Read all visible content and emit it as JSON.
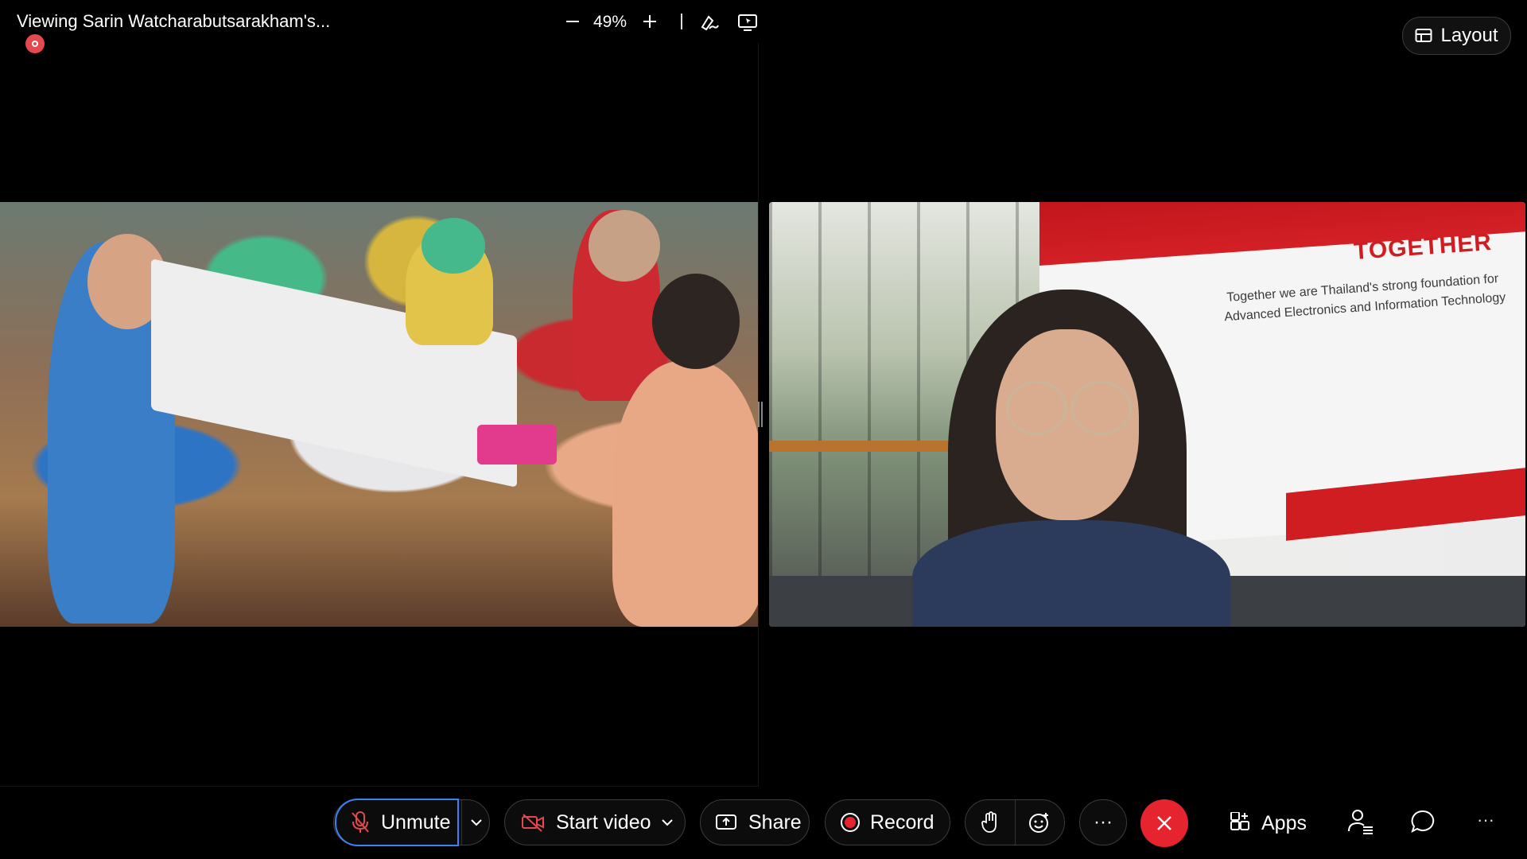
{
  "share": {
    "title": "Viewing Sarin Watcharabutsarakham's...",
    "zoom": "49%"
  },
  "participant_video": {
    "brand_text": "TOGETHER",
    "tagline_line1": "Together we are Thailand's strong foundation for",
    "tagline_line2": "Advanced Electronics and Information Technology"
  },
  "header": {
    "layout_label": "Layout"
  },
  "toolbar": {
    "unmute_label": "Unmute",
    "start_video_label": "Start video",
    "share_label": "Share",
    "record_label": "Record",
    "more_label": "···",
    "apps_label": "Apps",
    "overflow_label": "···"
  },
  "icons": {
    "recording": "recording-indicator-icon",
    "annotate": "annotate-icon",
    "remote_control": "remote-control-icon",
    "layout": "layout-icon",
    "mic_muted": "mic-muted-icon",
    "video_off": "video-off-icon",
    "share": "share-screen-icon",
    "record": "record-icon",
    "raise_hand": "raise-hand-icon",
    "reactions": "reactions-icon",
    "end": "end-call-icon",
    "apps": "apps-icon",
    "participants": "participants-icon",
    "chat": "chat-icon"
  },
  "colors": {
    "end_call": "#e5242f",
    "recording": "#e5484d",
    "active_border": "#3b82f6",
    "background": "#000000"
  }
}
